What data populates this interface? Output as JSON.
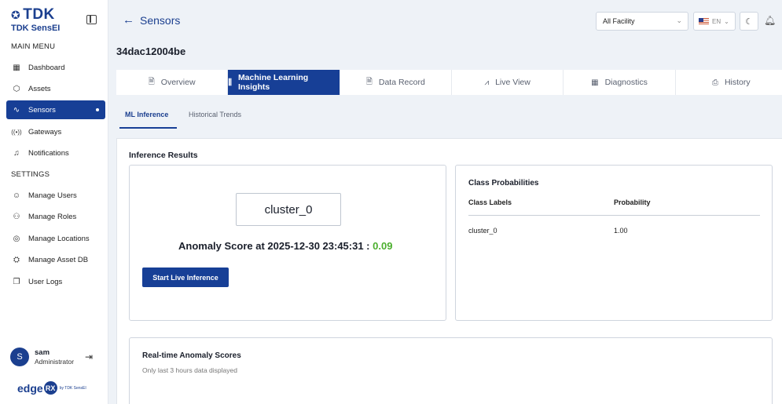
{
  "brand": {
    "name": "TDK",
    "product": "TDK SensEI"
  },
  "sidebar": {
    "main_menu_label": "MAIN MENU",
    "main_items": [
      {
        "label": "Dashboard",
        "icon": "dashboard-icon"
      },
      {
        "label": "Assets",
        "icon": "cube-icon"
      },
      {
        "label": "Sensors",
        "icon": "pulse-icon",
        "active": true
      },
      {
        "label": "Gateways",
        "icon": "broadcast-icon"
      },
      {
        "label": "Notifications",
        "icon": "bell-icon"
      }
    ],
    "settings_label": "SETTINGS",
    "settings_items": [
      {
        "label": "Manage Users",
        "icon": "user-icon"
      },
      {
        "label": "Manage Roles",
        "icon": "roles-icon"
      },
      {
        "label": "Manage Locations",
        "icon": "location-pin-icon"
      },
      {
        "label": "Manage Asset DB",
        "icon": "database-icon"
      },
      {
        "label": "User Logs",
        "icon": "logs-icon"
      }
    ]
  },
  "user": {
    "initial": "S",
    "name": "sam",
    "role": "Administrator"
  },
  "footer_logo": {
    "text": "edge",
    "badge": "RX",
    "tagline": "by TDK SensEI"
  },
  "header": {
    "back_label": "Sensors",
    "facility_select": "All Facility",
    "language": "EN"
  },
  "device_id": "34dac12004be",
  "tabs": [
    {
      "label": "Overview",
      "icon": "document-icon"
    },
    {
      "label": "Machine Learning Insights",
      "icon": "ml-icon",
      "active": true
    },
    {
      "label": "Data Record",
      "icon": "record-icon"
    },
    {
      "label": "Live View",
      "icon": "chart-icon"
    },
    {
      "label": "Diagnostics",
      "icon": "diagnostics-icon"
    },
    {
      "label": "History",
      "icon": "history-icon"
    }
  ],
  "subtabs": [
    {
      "label": "ML Inference",
      "active": true
    },
    {
      "label": "Historical Trends"
    }
  ],
  "inference": {
    "title": "Inference Results",
    "cluster": "cluster_0",
    "anomaly_label": "Anomaly Score at 2025-12-30 23:45:31 : ",
    "anomaly_score": "0.09",
    "start_button": "Start Live Inference"
  },
  "class_probabilities": {
    "title": "Class Probabilities",
    "columns": [
      "Class Labels",
      "Probability"
    ],
    "rows": [
      [
        "cluster_0",
        "1.00"
      ]
    ]
  },
  "realtime": {
    "title": "Real-time Anomaly Scores",
    "subtitle": "Only last 3 hours data displayed"
  },
  "colors": {
    "primary": "#173f96",
    "score_green": "#4caf2f",
    "background": "#eef2f7"
  }
}
